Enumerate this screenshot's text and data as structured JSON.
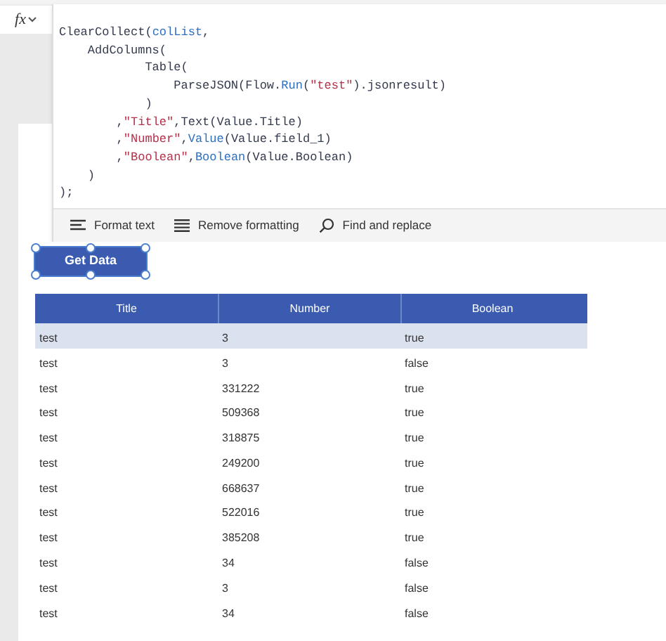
{
  "formula_bar": {
    "fx_label": "fx",
    "code_lines": [
      [
        {
          "text": "ClearCollect(",
          "kind": "plain"
        },
        {
          "text": "colList",
          "kind": "ident"
        },
        {
          "text": ",",
          "kind": "plain"
        }
      ],
      [
        {
          "text": "    AddColumns(",
          "kind": "plain"
        }
      ],
      [
        {
          "text": "            Table(",
          "kind": "plain"
        }
      ],
      [
        {
          "text": "                ParseJSON(Flow.",
          "kind": "plain"
        },
        {
          "text": "Run",
          "kind": "ident"
        },
        {
          "text": "(",
          "kind": "plain"
        },
        {
          "text": "\"test\"",
          "kind": "string"
        },
        {
          "text": ").jsonresult)",
          "kind": "plain"
        }
      ],
      [
        {
          "text": "            )",
          "kind": "plain"
        }
      ],
      [
        {
          "text": "        ,",
          "kind": "plain"
        },
        {
          "text": "\"Title\"",
          "kind": "string"
        },
        {
          "text": ",Text(Value.Title)",
          "kind": "plain"
        }
      ],
      [
        {
          "text": "        ,",
          "kind": "plain"
        },
        {
          "text": "\"Number\"",
          "kind": "string"
        },
        {
          "text": ",",
          "kind": "plain"
        },
        {
          "text": "Value",
          "kind": "ident"
        },
        {
          "text": "(Value.field_1)",
          "kind": "plain"
        }
      ],
      [
        {
          "text": "        ,",
          "kind": "plain"
        },
        {
          "text": "\"Boolean\"",
          "kind": "string"
        },
        {
          "text": ",",
          "kind": "plain"
        },
        {
          "text": "Boolean",
          "kind": "ident"
        },
        {
          "text": "(Value.Boolean)",
          "kind": "plain"
        }
      ],
      [
        {
          "text": "    )",
          "kind": "plain"
        }
      ],
      [
        {
          "text": ");",
          "kind": "plain"
        }
      ]
    ],
    "toolbar": [
      {
        "label": "Format text",
        "kind": "format"
      },
      {
        "label": "Remove formatting",
        "kind": "remove"
      },
      {
        "label": "Find and replace",
        "kind": "find"
      }
    ]
  },
  "canvas": {
    "button": {
      "label": "Get Data",
      "selected": true
    },
    "table": {
      "columns": [
        "Title",
        "Number",
        "Boolean"
      ],
      "rows": [
        {
          "cells": [
            "test",
            "3",
            "true"
          ],
          "selected": true
        },
        {
          "cells": [
            "test",
            "3",
            "false"
          ],
          "selected": false
        },
        {
          "cells": [
            "test",
            "331222",
            "true"
          ],
          "selected": false
        },
        {
          "cells": [
            "test",
            "509368",
            "true"
          ],
          "selected": false
        },
        {
          "cells": [
            "test",
            "318875",
            "true"
          ],
          "selected": false
        },
        {
          "cells": [
            "test",
            "249200",
            "true"
          ],
          "selected": false
        },
        {
          "cells": [
            "test",
            "668637",
            "true"
          ],
          "selected": false
        },
        {
          "cells": [
            "test",
            "522016",
            "true"
          ],
          "selected": false
        },
        {
          "cells": [
            "test",
            "385208",
            "true"
          ],
          "selected": false
        },
        {
          "cells": [
            "test",
            "34",
            "false"
          ],
          "selected": false
        },
        {
          "cells": [
            "test",
            "3",
            "false"
          ],
          "selected": false
        },
        {
          "cells": [
            "test",
            "34",
            "false"
          ],
          "selected": false
        }
      ]
    }
  }
}
